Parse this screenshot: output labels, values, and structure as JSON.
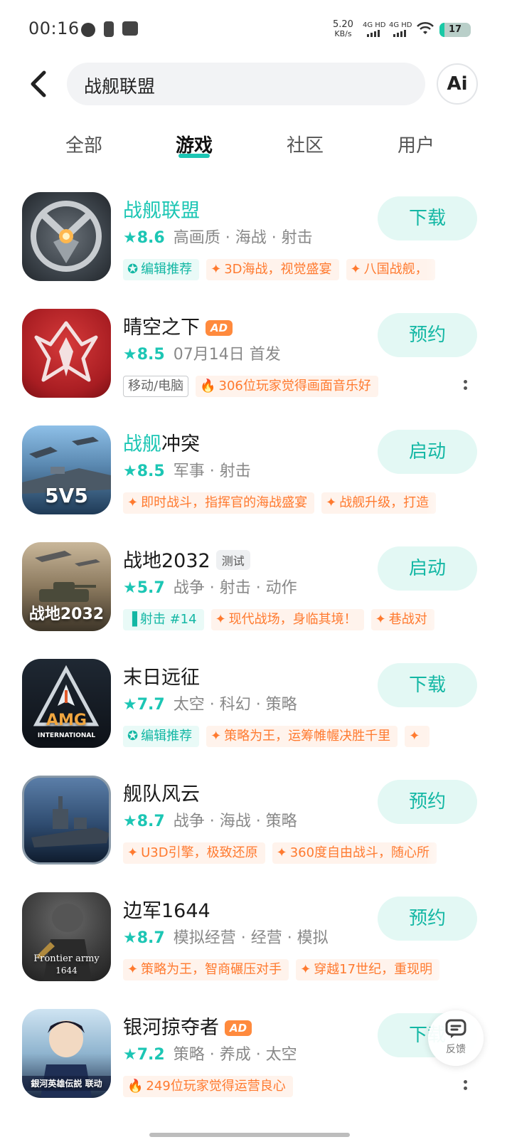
{
  "status_bar": {
    "time": "00:16",
    "speed_value": "5.20",
    "speed_unit": "KB/s",
    "net1": "4G HD",
    "net2": "4G HD",
    "battery": "17"
  },
  "search": {
    "query": "战舰联盟",
    "ai_label": "Ai"
  },
  "tabs": [
    {
      "label": "全部"
    },
    {
      "label": "游戏"
    },
    {
      "label": "社区"
    },
    {
      "label": "用户"
    }
  ],
  "results": [
    {
      "name_highlight": "战舰联盟",
      "name_rest": "",
      "badge": "",
      "score": "8.6",
      "category": "高画质 · 海战 · 射击",
      "action": "下载",
      "tags": [
        {
          "icon": "✪",
          "text": "编辑推荐",
          "style": "teal"
        },
        {
          "icon": "✦",
          "text": "3D海战，视觉盛宴",
          "style": "orange"
        },
        {
          "icon": "✦",
          "text": "八国战舰，",
          "style": "orange"
        }
      ]
    },
    {
      "name_highlight": "",
      "name_rest": "晴空之下",
      "badge": "AD",
      "score": "8.5",
      "category": "07月14日 首发",
      "action": "预约",
      "tags": [
        {
          "icon": "",
          "text": "移动/电脑",
          "style": "outline"
        },
        {
          "icon": "🔥",
          "text": "306位玩家觉得画面音乐好",
          "style": "orange"
        }
      ]
    },
    {
      "name_highlight": "战舰",
      "name_rest": "冲突",
      "badge": "",
      "score": "8.5",
      "category": "军事 · 射击",
      "action": "启动",
      "tags": [
        {
          "icon": "✦",
          "text": "即时战斗，指挥官的海战盛宴",
          "style": "orange"
        },
        {
          "icon": "✦",
          "text": "战舰升级，打造",
          "style": "orange"
        }
      ]
    },
    {
      "name_highlight": "",
      "name_rest": "战地2032",
      "badge": "测试",
      "score": "5.7",
      "category": "战争 · 射击 · 动作",
      "action": "启动",
      "tags": [
        {
          "icon": "▐",
          "text": "射击 #14",
          "style": "teal"
        },
        {
          "icon": "✦",
          "text": "现代战场，身临其境！",
          "style": "orange"
        },
        {
          "icon": "✦",
          "text": "巷战对",
          "style": "orange"
        }
      ]
    },
    {
      "name_highlight": "",
      "name_rest": "末日远征",
      "badge": "",
      "score": "7.7",
      "category": "太空 · 科幻 · 策略",
      "action": "下载",
      "tags": [
        {
          "icon": "✪",
          "text": "编辑推荐",
          "style": "teal"
        },
        {
          "icon": "✦",
          "text": "策略为王，运筹帷幄决胜千里",
          "style": "orange"
        },
        {
          "icon": "✦",
          "text": "",
          "style": "orange"
        }
      ]
    },
    {
      "name_highlight": "",
      "name_rest": "舰队风云",
      "badge": "",
      "score": "8.7",
      "category": "战争 · 海战 · 策略",
      "action": "预约",
      "tags": [
        {
          "icon": "✦",
          "text": "U3D引擎，极致还原",
          "style": "orange"
        },
        {
          "icon": "✦",
          "text": "360度自由战斗，随心所",
          "style": "orange"
        }
      ]
    },
    {
      "name_highlight": "",
      "name_rest": "边军1644",
      "badge": "",
      "score": "8.7",
      "category": "模拟经营 · 经营 · 模拟",
      "action": "预约",
      "tags": [
        {
          "icon": "✦",
          "text": "策略为王，智商碾压对手",
          "style": "orange"
        },
        {
          "icon": "✦",
          "text": "穿越17世纪，重现明",
          "style": "orange"
        }
      ]
    },
    {
      "name_highlight": "",
      "name_rest": "银河掠夺者",
      "badge": "AD",
      "score": "7.2",
      "category": "策略 · 养成 · 太空",
      "action": "下载",
      "tags": [
        {
          "icon": "🔥",
          "text": "249位玩家觉得运营良心",
          "style": "orange"
        }
      ]
    }
  ],
  "icon_texts": {
    "zhankuang_chongtu": "5V5",
    "zhandi": "战地2032",
    "amg": "AMG",
    "amg_sub": "INTERNATIONAL",
    "bianjun": "Frontier army",
    "bianjun_sub": "1644",
    "yinhe": "銀河英雄伝説 联动"
  },
  "feedback_label": "反馈",
  "colors": {
    "accent": "#1cc6b4",
    "orange": "#ff7a2f",
    "ad": "#ff8a3d"
  }
}
